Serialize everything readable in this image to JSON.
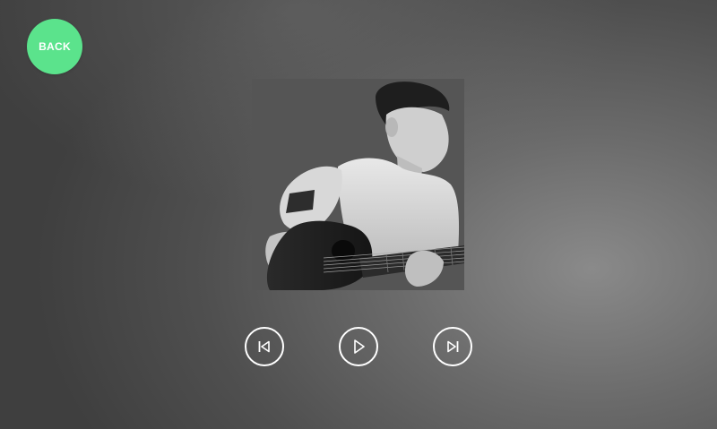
{
  "back_button": {
    "label": "BACK"
  },
  "album_art": {
    "description_icon": "artist-photo"
  },
  "controls": {
    "previous_icon": "skip-previous-icon",
    "play_icon": "play-icon",
    "next_icon": "skip-next-icon"
  },
  "colors": {
    "back_button": "#5be38c",
    "control_stroke": "#ffffff"
  }
}
